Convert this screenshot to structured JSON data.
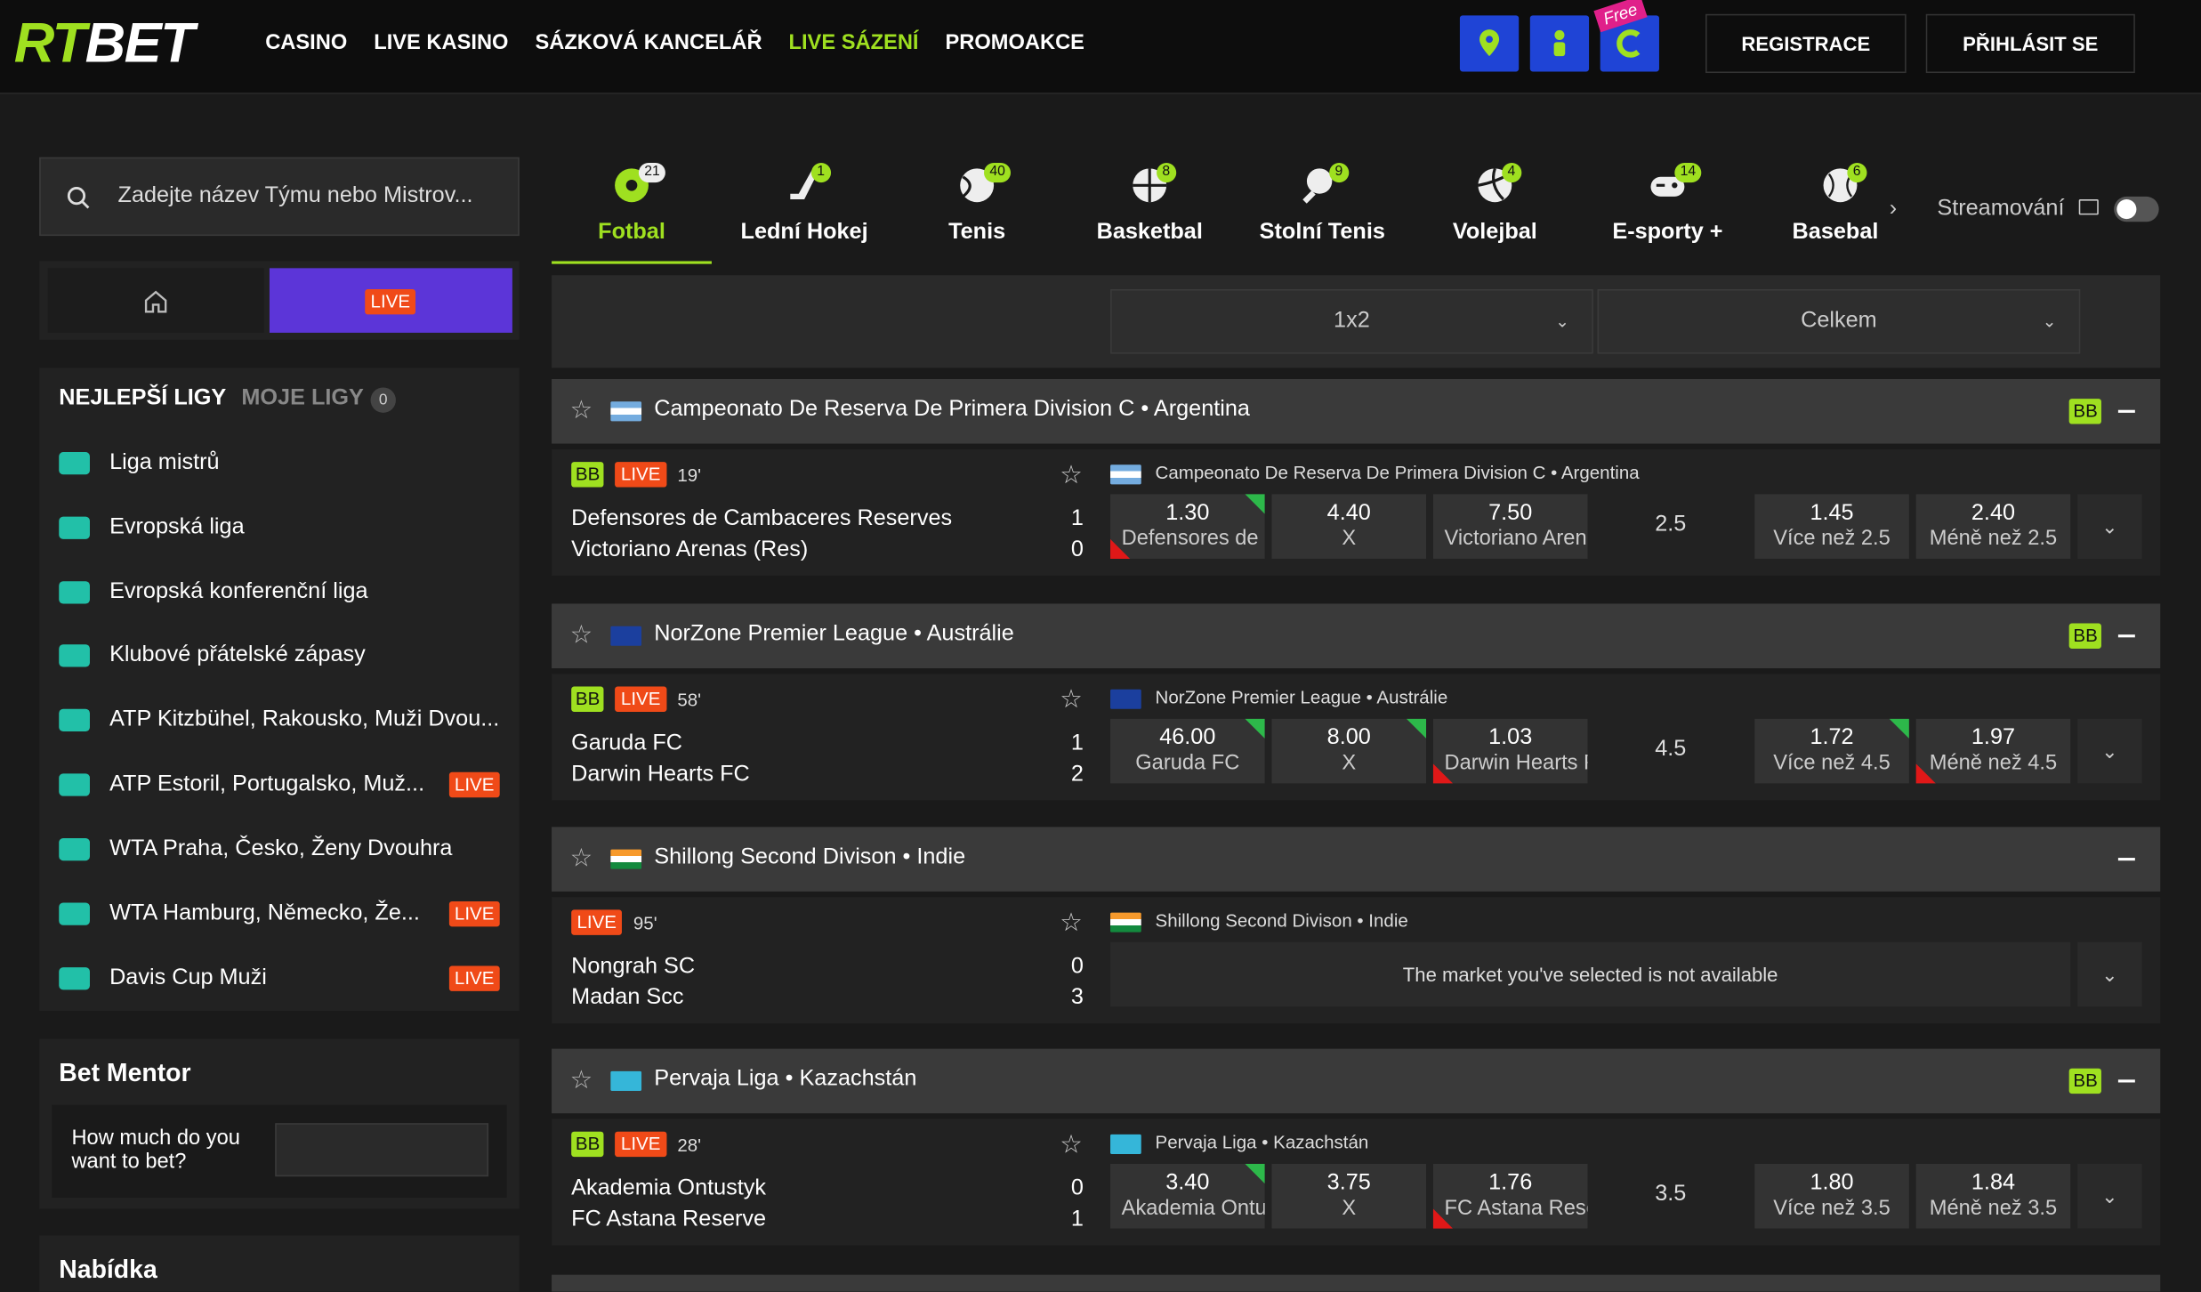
{
  "header": {
    "logo_part1": "RT",
    "logo_part2": "BET",
    "nav": [
      "CASINO",
      "LIVE KASINO",
      "SÁZKOVÁ KANCELÁŘ",
      "LIVE SÁZENÍ",
      "PROMOAKCE"
    ],
    "active_nav": "LIVE SÁZENÍ",
    "free_tag": "Free",
    "register": "REGISTRACE",
    "login": "PŘIHLÁSIT SE"
  },
  "colors": {
    "accent": "#9fe020",
    "live": "#f04a18",
    "quick_icon": "#1f44d6",
    "live_tab": "#5c35d8",
    "odd_up": "#2db84a",
    "odd_down": "#e01818"
  },
  "sidebar": {
    "search_placeholder": "Zadejte název Týmu nebo Mistrov...",
    "home_icon": "home-icon",
    "live_tab": "LIVE",
    "tab_top": "NEJLEPŠÍ LIGY",
    "tab_my": "MOJE LIGY",
    "my_count": "0",
    "leagues": [
      {
        "name": "Liga mistrů",
        "live": ""
      },
      {
        "name": "Evropská liga",
        "live": ""
      },
      {
        "name": "Evropská konferenční liga",
        "live": ""
      },
      {
        "name": "Klubové přátelské zápasy",
        "live": ""
      },
      {
        "name": "ATP Kitzbühel, Rakousko, Muži Dvou...",
        "live": ""
      },
      {
        "name": "ATP Estoril, Portugalsko, Muž...",
        "live": "LIVE"
      },
      {
        "name": "WTA Praha, Česko, Ženy Dvouhra",
        "live": ""
      },
      {
        "name": "WTA Hamburg, Německo, Že...",
        "live": "LIVE"
      },
      {
        "name": "Davis Cup Muži",
        "live": "LIVE"
      }
    ],
    "mentor_title": "Bet Mentor",
    "mentor_question": "How much do you want to bet?",
    "offer_title": "Nabídka"
  },
  "sports": [
    {
      "name": "Fotbal",
      "count": "21",
      "icon": "football-icon"
    },
    {
      "name": "Lední Hokej",
      "count": "1",
      "icon": "hockey-icon"
    },
    {
      "name": "Tenis",
      "count": "40",
      "icon": "tennis-icon"
    },
    {
      "name": "Basketbal",
      "count": "8",
      "icon": "basketball-icon"
    },
    {
      "name": "Stolní Tenis",
      "count": "9",
      "icon": "table-tennis-icon"
    },
    {
      "name": "Volejbal",
      "count": "4",
      "icon": "volleyball-icon"
    },
    {
      "name": "E-sporty +",
      "count": "14",
      "icon": "esports-icon"
    },
    {
      "name": "Basebal",
      "count": "6",
      "icon": "baseball-icon"
    }
  ],
  "streaming_label": "Streamování",
  "filters": {
    "market": "1x2",
    "period": "Celkem"
  },
  "events": [
    {
      "league": "Campeonato De Reserva De Primera Division C • Argentina",
      "bb": "BB",
      "minute": "19'",
      "home": "Defensores de Cambaceres Reserves",
      "away": "Victoriano Arenas (Res)",
      "score_home": "1",
      "score_away": "0",
      "odds": [
        {
          "value": "1.30",
          "label": "Defensores de Cambaceres Reserves",
          "trend": "updown"
        },
        {
          "value": "4.40",
          "label": "X",
          "trend": ""
        },
        {
          "value": "7.50",
          "label": "Victoriano Arenas (Res)",
          "trend": ""
        }
      ],
      "line": "2.5",
      "totals": [
        {
          "value": "1.45",
          "label": "Více než 2.5",
          "trend": ""
        },
        {
          "value": "2.40",
          "label": "Méně než 2.5",
          "trend": ""
        }
      ],
      "unavailable": ""
    },
    {
      "league": "NorZone Premier League • Austrálie",
      "bb": "BB",
      "minute": "58'",
      "home": "Garuda FC",
      "away": "Darwin Hearts FC",
      "score_home": "1",
      "score_away": "2",
      "odds": [
        {
          "value": "46.00",
          "label": "Garuda FC",
          "trend": "up"
        },
        {
          "value": "8.00",
          "label": "X",
          "trend": "up"
        },
        {
          "value": "1.03",
          "label": "Darwin Hearts FC",
          "trend": "down"
        }
      ],
      "line": "4.5",
      "totals": [
        {
          "value": "1.72",
          "label": "Více než 4.5",
          "trend": "up"
        },
        {
          "value": "1.97",
          "label": "Méně než 4.5",
          "trend": "down"
        }
      ],
      "unavailable": ""
    },
    {
      "league": "Shillong Second Divison • Indie",
      "bb": "",
      "minute": "95'",
      "home": "Nongrah SC",
      "away": "Madan Scc",
      "score_home": "0",
      "score_away": "3",
      "odds": [],
      "line": "",
      "totals": [],
      "unavailable": "The market you've selected is not available"
    },
    {
      "league": "Pervaja Liga • Kazachstán",
      "bb": "BB",
      "minute": "28'",
      "home": "Akademia Ontustyk",
      "away": "FC Astana Reserve",
      "score_home": "0",
      "score_away": "1",
      "odds": [
        {
          "value": "3.40",
          "label": "Akademia Ontustyk",
          "trend": "up"
        },
        {
          "value": "3.75",
          "label": "X",
          "trend": ""
        },
        {
          "value": "1.76",
          "label": "FC Astana Reserve",
          "trend": "down"
        }
      ],
      "line": "3.5",
      "totals": [
        {
          "value": "1.80",
          "label": "Více než 3.5",
          "trend": ""
        },
        {
          "value": "1.84",
          "label": "Méně než 3.5",
          "trend": ""
        }
      ],
      "unavailable": ""
    }
  ]
}
